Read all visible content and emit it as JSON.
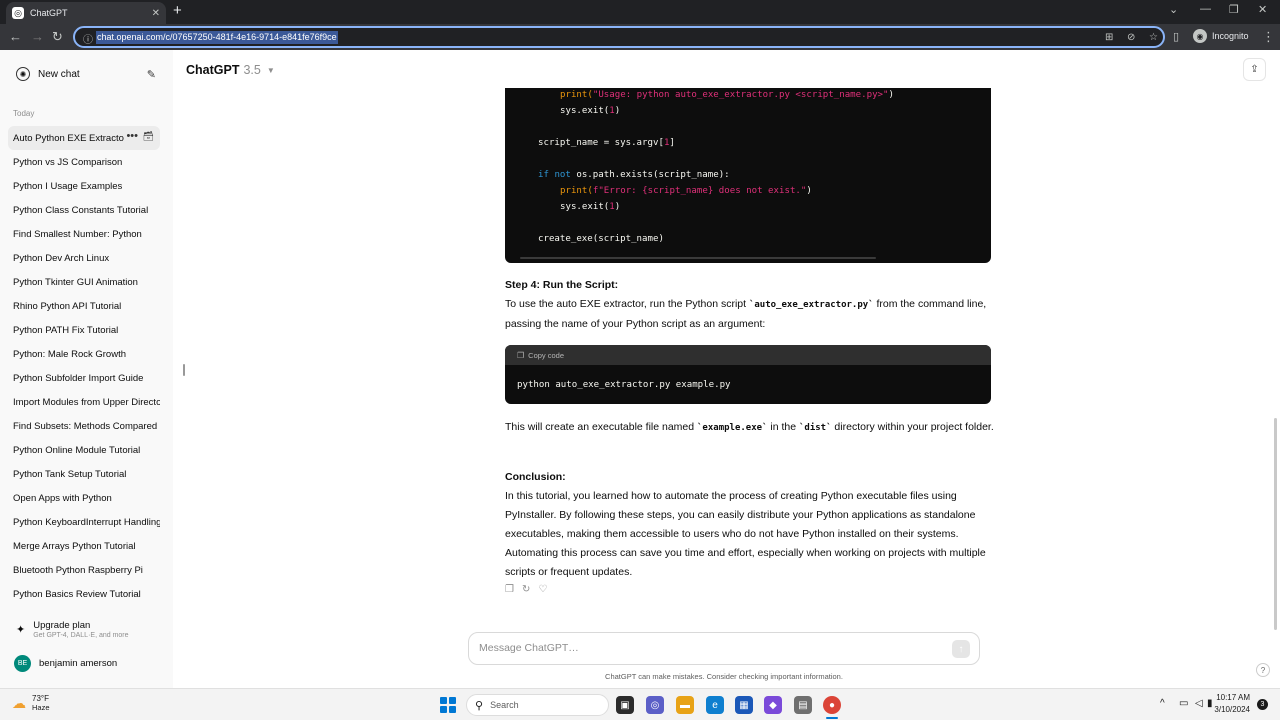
{
  "browser": {
    "tab_title": "ChatGPT",
    "url": "chat.openai.com/c/07657250-481f-4e16-9714-e841fe76f9ce",
    "incognito_label": "Incognito"
  },
  "sidebar": {
    "new_chat_label": "New chat",
    "section_label": "Today",
    "history": [
      "Auto Python EXE Extractor",
      "Python vs JS Comparison",
      "Python I Usage Examples",
      "Python Class Constants Tutorial",
      "Find Smallest Number: Python",
      "Python Dev Arch Linux",
      "Python Tkinter GUI Animation",
      "Rhino Python API Tutorial",
      "Python PATH Fix Tutorial",
      "Python: Male Rock Growth",
      "Python Subfolder Import Guide",
      "Import Modules from Upper Directory",
      "Find Subsets: Methods Compared",
      "Python Online Module Tutorial",
      "Python Tank Setup Tutorial",
      "Open Apps with Python",
      "Python KeyboardInterrupt Handling",
      "Merge Arrays Python Tutorial",
      "Bluetooth Python Raspberry Pi",
      "Python Basics Review Tutorial"
    ],
    "upgrade_title": "Upgrade plan",
    "upgrade_subtitle": "Get GPT-4, DALL·E, and more",
    "user_initials": "BE",
    "user_name": "benjamin amerson"
  },
  "header": {
    "model_name": "ChatGPT",
    "model_version": "3.5"
  },
  "code1": {
    "l1_fn": "print(",
    "l1_str": "\"Usage: python auto_exe_extractor.py <script_name.py>\"",
    "l1_end": ")",
    "l2": "sys.exit(",
    "l2_num": "1",
    "l2_end": ")",
    "l3": "script_name = sys.argv[",
    "l3_num": "1",
    "l3_end": "]",
    "l4_kw1": "if",
    "l4_kw2": "not",
    "l4_rest": " os.path.exists(script_name):",
    "l5_fn": "print(",
    "l5_str": "f\"Error: {script_name} does not exist.\"",
    "l5_end": ")",
    "l6": "sys.exit(",
    "l6_num": "1",
    "l6_end": ")",
    "l7": "create_exe(script_name)"
  },
  "step4": {
    "heading": "Step 4: Run the Script:",
    "p1_a": "To use the auto EXE extractor, run the Python script ",
    "p1_code": "`auto_exe_extractor.py`",
    "p1_b": " from the command line, passing the name of your Python script as an argument:"
  },
  "code2": {
    "copy_label": "Copy code",
    "code": "python auto_exe_extractor.py example.py"
  },
  "after_code": {
    "a": "This will create an executable file named ",
    "code1": "`example.exe`",
    "b": " in the ",
    "code2": "`dist`",
    "c": " directory within your project folder."
  },
  "conclusion": {
    "heading": "Conclusion:",
    "text": "In this tutorial, you learned how to automate the process of creating Python executable files using PyInstaller. By following these steps, you can easily distribute your Python applications as standalone executables, making them accessible to users who do not have Python installed on their systems. Automating this process can save you time and effort, especially when working on projects with multiple scripts or frequent updates."
  },
  "composer": {
    "placeholder": "Message ChatGPT…",
    "disclaimer": "ChatGPT can make mistakes. Consider checking important information."
  },
  "taskbar": {
    "temp": "73°F",
    "weather": "Haze",
    "search_label": "Search",
    "time": "10:17 AM",
    "date": "3/10/2024",
    "notifications": "3"
  },
  "icons": {
    "send": "arrow-up-icon",
    "share": "share-icon",
    "copy": "clipboard-icon"
  }
}
